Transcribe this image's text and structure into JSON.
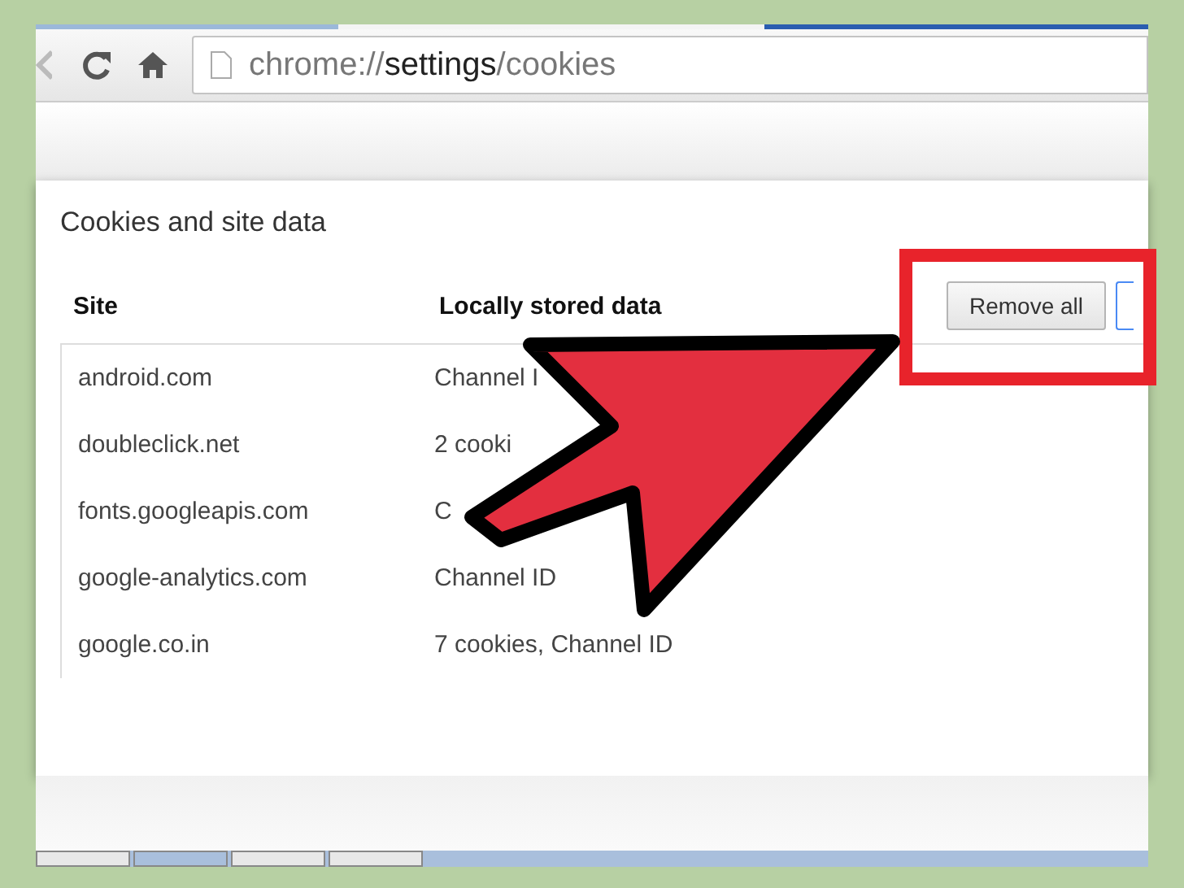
{
  "toolbar": {
    "url": {
      "scheme": "chrome://",
      "host": "settings",
      "path": "/cookies"
    }
  },
  "dialog": {
    "title": "Cookies and site data",
    "columns": [
      "Site",
      "Locally stored data"
    ],
    "buttons": [
      {
        "label": "Remove all",
        "highlighted": true
      }
    ],
    "rows": [
      {
        "site": "android.com",
        "data": "Channel I"
      },
      {
        "site": "doubleclick.net",
        "data": "2 cooki"
      },
      {
        "site": "fonts.googleapis.com",
        "data": "C"
      },
      {
        "site": "google-analytics.com",
        "data": "Channel ID"
      },
      {
        "site": "google.co.in",
        "data": "7 cookies, Channel ID"
      }
    ]
  }
}
